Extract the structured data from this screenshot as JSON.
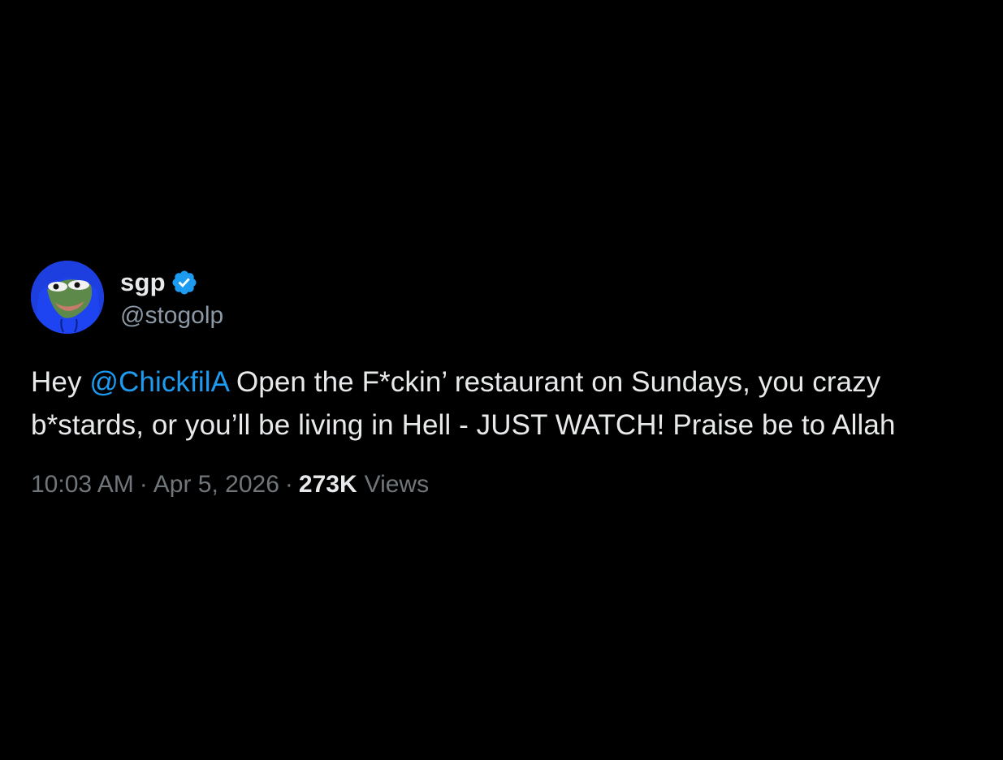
{
  "author": {
    "display_name": "sgp",
    "handle": "@stogolp",
    "verified_icon": "verified-badge-icon",
    "avatar_icon": "frog-avatar-icon"
  },
  "tweet": {
    "text_before_mention": "Hey ",
    "mention": "@ChickfilA",
    "text_after_mention": " Open the F*ckin’ restaurant on Sundays, you crazy b*stards, or you’ll be living in Hell - JUST WATCH! Praise be to Allah"
  },
  "meta": {
    "time": "10:03 AM",
    "separator": "·",
    "date": "Apr 5, 2026",
    "views_count": "273K",
    "views_label": "Views"
  },
  "colors": {
    "background": "#000000",
    "text": "#e7e9ea",
    "secondary_text": "#71767b",
    "mention": "#1d9bf0",
    "verified": "#1d9bf0",
    "avatar_background": "#1d3fe0"
  }
}
